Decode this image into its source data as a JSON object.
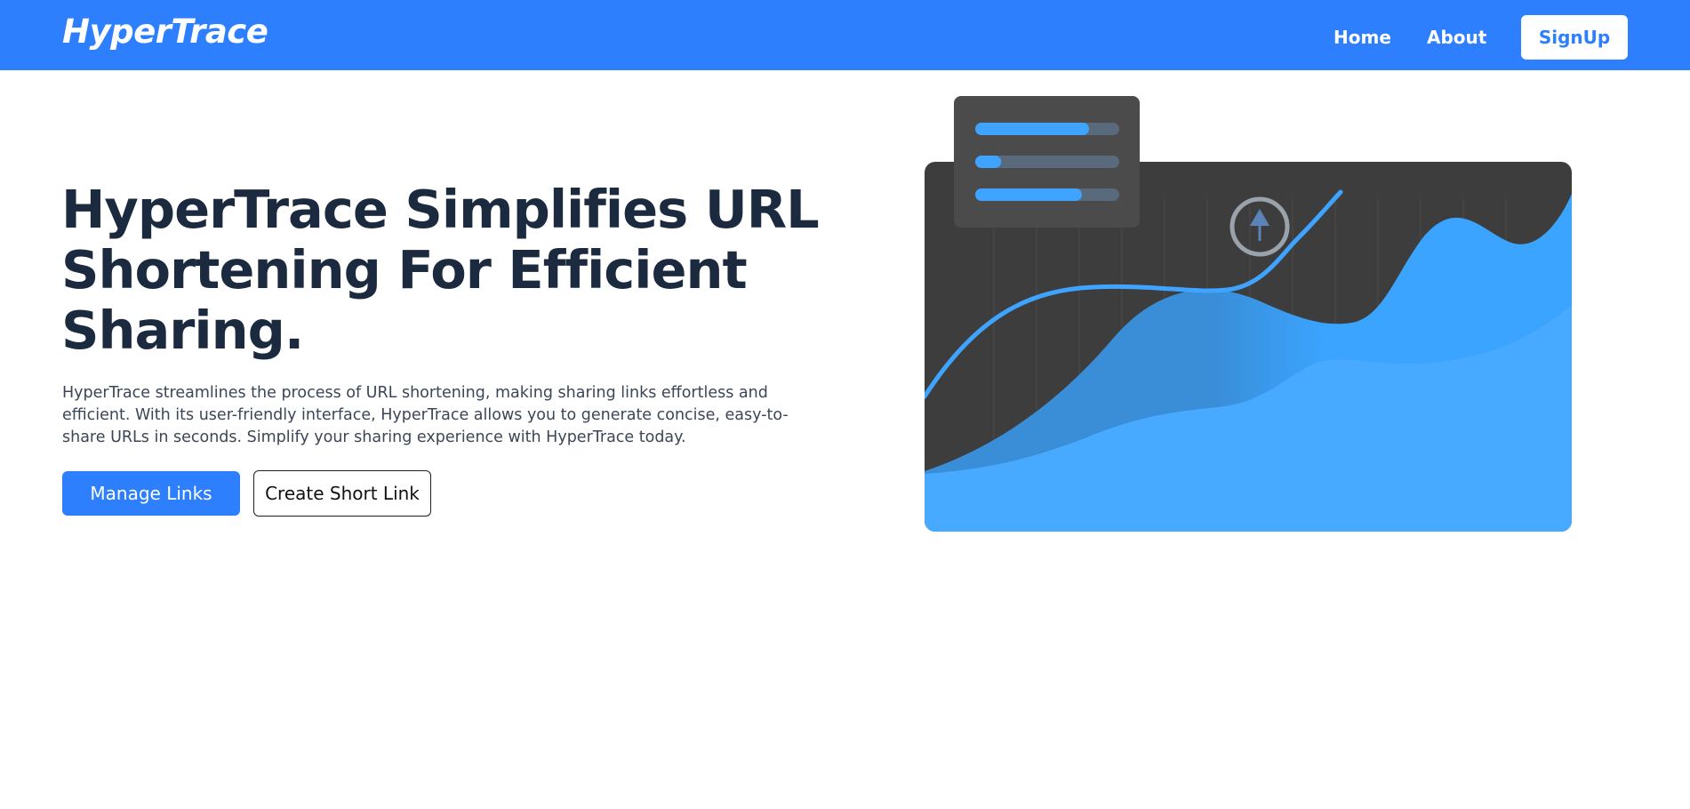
{
  "navbar": {
    "brand": "HyperTrace",
    "links": [
      "Home",
      "About"
    ],
    "signup_label": "SignUp",
    "background": "#2d7ffe"
  },
  "hero": {
    "title": "HyperTrace Simplifies URL Shortening For Efficient Sharing.",
    "description": "HyperTrace streamlines the process of URL shortening, making sharing links effortless and efficient. With its user-friendly interface, HyperTrace allows you to generate concise, easy-to-share URLs in seconds. Simplify your sharing experience with HyperTrace today.",
    "primary_button": "Manage Links",
    "secondary_button": "Create Short Link"
  },
  "illustration": {
    "card_colors": {
      "panel": "#3d3d3d",
      "floating_card": "#4b4b4b",
      "accent": "#3ea4ff",
      "track": "#5a6a7d"
    },
    "progress_bars": [
      0.79,
      0.18,
      0.74
    ],
    "icon": "arrow-up-circle-icon"
  },
  "colors": {
    "accent": "#2d7ffe",
    "heading": "#1c2a3f",
    "body_text": "#3b4656"
  }
}
